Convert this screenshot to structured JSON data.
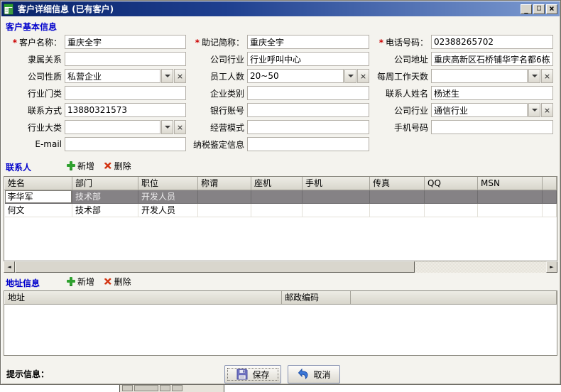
{
  "window": {
    "title": "客户详细信息 (已有客户)"
  },
  "icons": {
    "minimize": "_",
    "maximize": "□",
    "close": "×",
    "clear": "×",
    "dropdown": "▼",
    "scroll_left": "◄",
    "scroll_right": "►",
    "add": "✚",
    "delete": "×"
  },
  "colors": {
    "titlebar_left": "#0a246a",
    "titlebar_right": "#7d9bd1",
    "section_title": "#0000cc",
    "required_marker": "#cc0000",
    "selected_row_bg": "#858285",
    "add_icon_green": "#2fa12f",
    "delete_icon_red": "#d23310"
  },
  "required_marker": "*",
  "basic_section": {
    "title": "客户基本信息",
    "fields": {
      "customer_name": {
        "label": "客户名称：",
        "value": "重庆全宇"
      },
      "mnemonic": {
        "label": "助记简称：",
        "value": "重庆全宇"
      },
      "phone": {
        "label": "电话号码：",
        "value": "02388265702"
      },
      "affiliation": {
        "label": "隶属关系",
        "value": ""
      },
      "company_industry": {
        "label": "公司行业",
        "value": "行业呼叫中心"
      },
      "company_address": {
        "label": "公司地址",
        "value": "重庆高新区石桥铺华宇名都6栋"
      },
      "company_nature": {
        "label": "公司性质",
        "value": "私营企业"
      },
      "employee_count": {
        "label": "员工人数",
        "value": "20~50"
      },
      "weekly_workdays": {
        "label": "每周工作天数",
        "value": ""
      },
      "industry_category": {
        "label": "行业门类",
        "value": ""
      },
      "enterprise_type": {
        "label": "企业类别",
        "value": ""
      },
      "contact_person": {
        "label": "联系人姓名",
        "value": "杨述生"
      },
      "contact_method": {
        "label": "联系方式",
        "value": "13880321573"
      },
      "bank_account": {
        "label": "银行账号",
        "value": ""
      },
      "company_industry2": {
        "label": "公司行业",
        "value": "通信行业"
      },
      "industry_major": {
        "label": "行业大类",
        "value": ""
      },
      "business_model": {
        "label": "经营模式",
        "value": ""
      },
      "mobile": {
        "label": "手机号码",
        "value": ""
      },
      "email": {
        "label": "E-mail",
        "value": ""
      },
      "tax_info": {
        "label": "纳税鉴定信息",
        "value": ""
      }
    }
  },
  "contacts_section": {
    "title": "联系人",
    "add_label": "新增",
    "delete_label": "删除",
    "table": {
      "headers": [
        "姓名",
        "部门",
        "职位",
        "称谓",
        "座机",
        "手机",
        "传真",
        "QQ",
        "MSN"
      ],
      "rows": [
        {
          "name": "李华军",
          "department": "技术部",
          "position": "开发人员",
          "salutation": "",
          "landline": "",
          "mobile": "",
          "fax": "",
          "qq": "",
          "msn": ""
        },
        {
          "name": "何文",
          "department": "技术部",
          "position": "开发人员",
          "salutation": "",
          "landline": "",
          "mobile": "",
          "fax": "",
          "qq": "",
          "msn": ""
        }
      ]
    }
  },
  "address_section": {
    "title": "地址信息",
    "add_label": "新增",
    "delete_label": "删除",
    "table": {
      "headers": [
        "地址",
        "邮政编码"
      ]
    }
  },
  "footer": {
    "hint_label": "提示信息：",
    "save_label": "保存",
    "cancel_label": "取消"
  }
}
